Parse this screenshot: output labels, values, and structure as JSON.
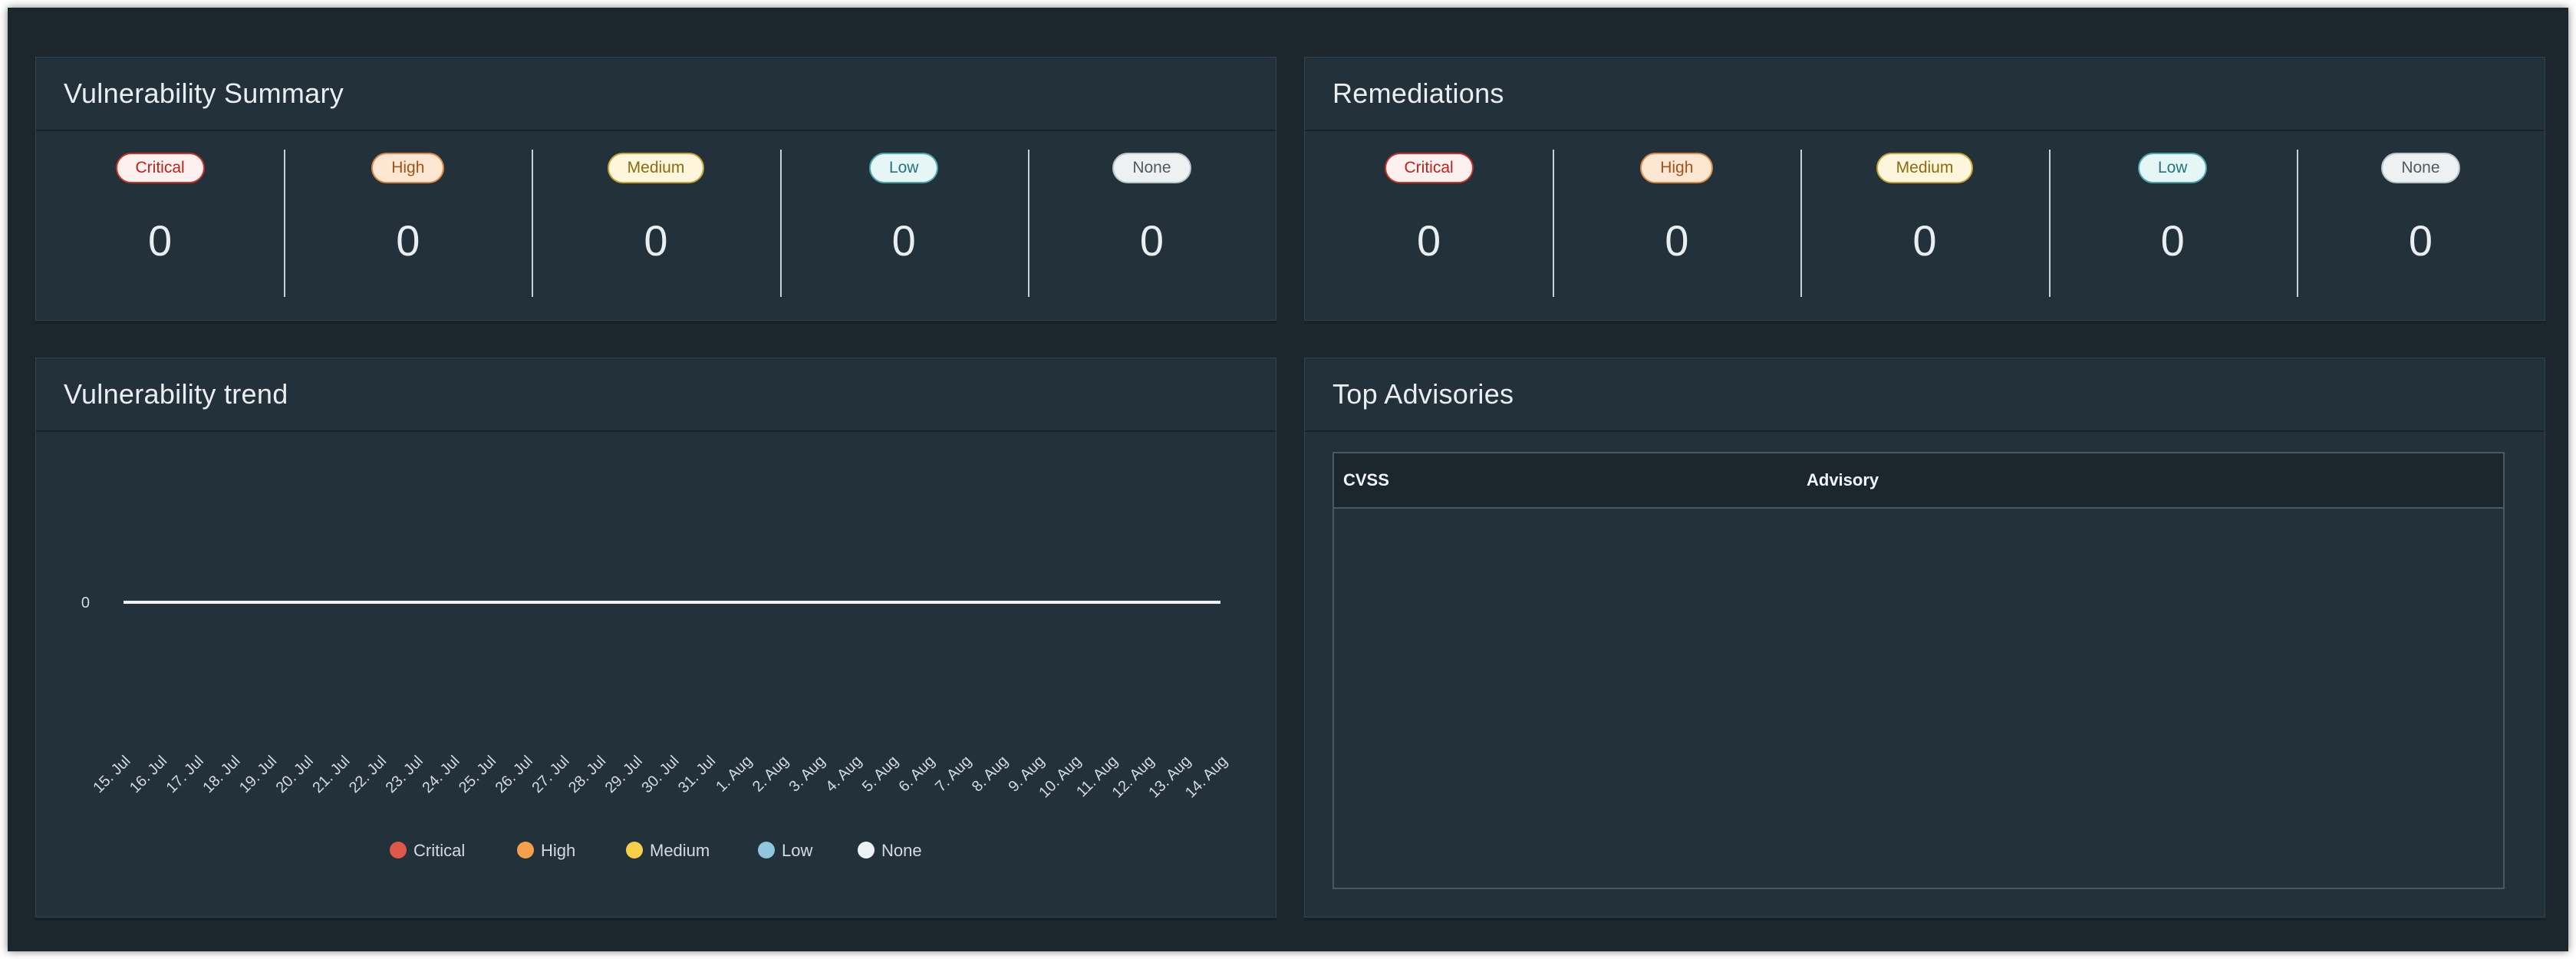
{
  "summary": {
    "title": "Vulnerability Summary",
    "items": [
      {
        "label": "Critical",
        "value": "0"
      },
      {
        "label": "High",
        "value": "0"
      },
      {
        "label": "Medium",
        "value": "0"
      },
      {
        "label": "Low",
        "value": "0"
      },
      {
        "label": "None",
        "value": "0"
      }
    ]
  },
  "remediations": {
    "title": "Remediations",
    "items": [
      {
        "label": "Critical",
        "value": "0"
      },
      {
        "label": "High",
        "value": "0"
      },
      {
        "label": "Medium",
        "value": "0"
      },
      {
        "label": "Low",
        "value": "0"
      },
      {
        "label": "None",
        "value": "0"
      }
    ]
  },
  "trend": {
    "title": "Vulnerability trend"
  },
  "advisories": {
    "title": "Top Advisories",
    "columns": [
      "CVSS",
      "Advisory"
    ]
  },
  "chart_data": {
    "type": "line",
    "x": [
      "15. Jul",
      "16. Jul",
      "17. Jul",
      "18. Jul",
      "19. Jul",
      "20. Jul",
      "21. Jul",
      "22. Jul",
      "23. Jul",
      "24. Jul",
      "25. Jul",
      "26. Jul",
      "27. Jul",
      "28. Jul",
      "29. Jul",
      "30. Jul",
      "31. Jul",
      "1. Aug",
      "2. Aug",
      "3. Aug",
      "4. Aug",
      "5. Aug",
      "6. Aug",
      "7. Aug",
      "8. Aug",
      "9. Aug",
      "10. Aug",
      "11. Aug",
      "12. Aug",
      "13. Aug",
      "14. Aug"
    ],
    "y_ticks": [
      "0"
    ],
    "series": [
      {
        "name": "Critical",
        "color": "#e0564a",
        "values": [
          0,
          0,
          0,
          0,
          0,
          0,
          0,
          0,
          0,
          0,
          0,
          0,
          0,
          0,
          0,
          0,
          0,
          0,
          0,
          0,
          0,
          0,
          0,
          0,
          0,
          0,
          0,
          0,
          0,
          0,
          0
        ]
      },
      {
        "name": "High",
        "color": "#f4a14e",
        "values": [
          0,
          0,
          0,
          0,
          0,
          0,
          0,
          0,
          0,
          0,
          0,
          0,
          0,
          0,
          0,
          0,
          0,
          0,
          0,
          0,
          0,
          0,
          0,
          0,
          0,
          0,
          0,
          0,
          0,
          0,
          0
        ]
      },
      {
        "name": "Medium",
        "color": "#f7cf4a",
        "values": [
          0,
          0,
          0,
          0,
          0,
          0,
          0,
          0,
          0,
          0,
          0,
          0,
          0,
          0,
          0,
          0,
          0,
          0,
          0,
          0,
          0,
          0,
          0,
          0,
          0,
          0,
          0,
          0,
          0,
          0,
          0
        ]
      },
      {
        "name": "Low",
        "color": "#8fc6e0",
        "values": [
          0,
          0,
          0,
          0,
          0,
          0,
          0,
          0,
          0,
          0,
          0,
          0,
          0,
          0,
          0,
          0,
          0,
          0,
          0,
          0,
          0,
          0,
          0,
          0,
          0,
          0,
          0,
          0,
          0,
          0,
          0
        ]
      },
      {
        "name": "None",
        "color": "#eef2f4",
        "values": [
          0,
          0,
          0,
          0,
          0,
          0,
          0,
          0,
          0,
          0,
          0,
          0,
          0,
          0,
          0,
          0,
          0,
          0,
          0,
          0,
          0,
          0,
          0,
          0,
          0,
          0,
          0,
          0,
          0,
          0,
          0
        ]
      }
    ],
    "legend_position": "bottom-center"
  }
}
